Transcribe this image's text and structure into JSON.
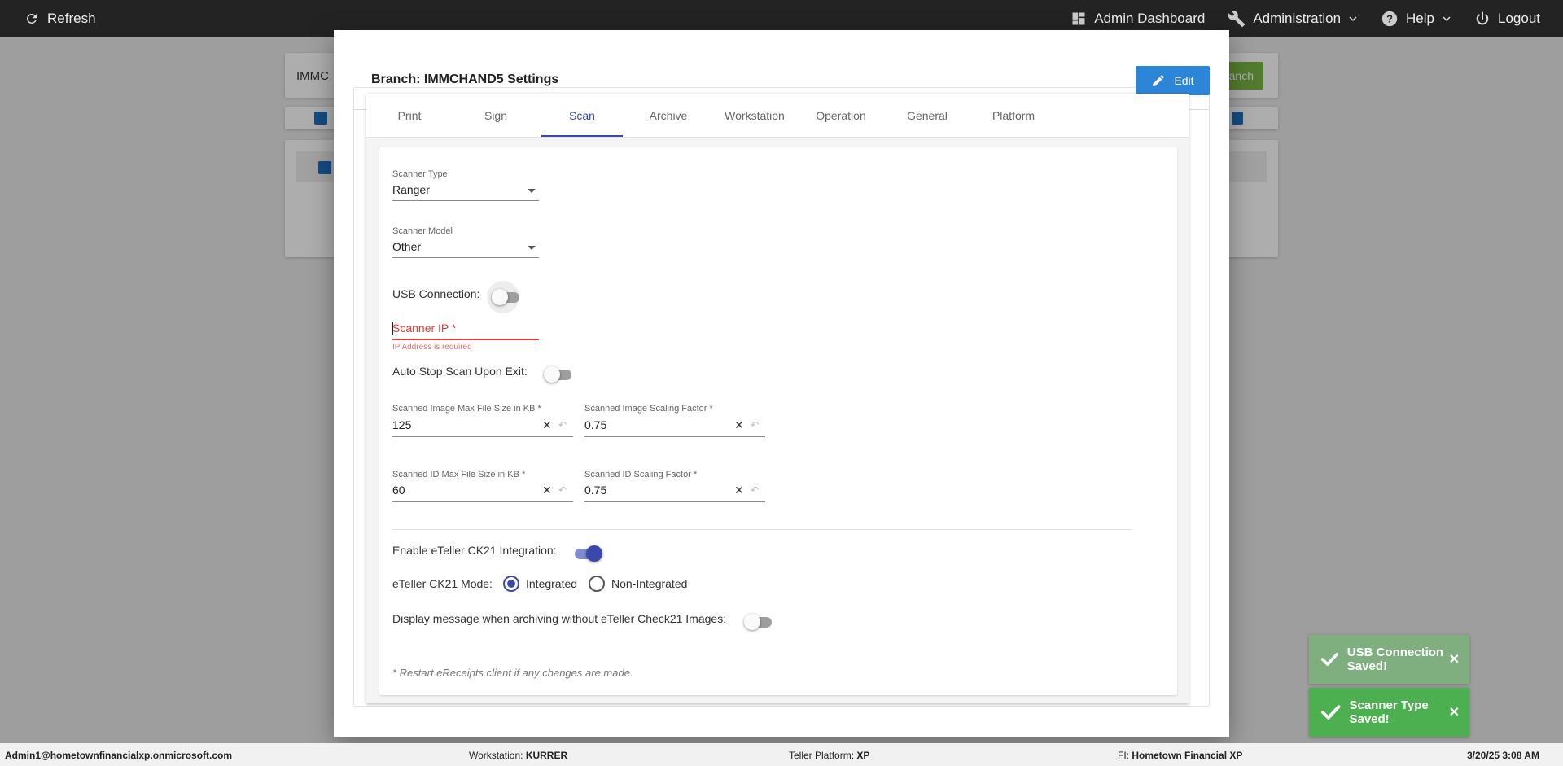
{
  "topnav": {
    "refresh_label": "Refresh",
    "admin_dashboard_label": "Admin Dashboard",
    "administration_label": "Administration",
    "help_label": "Help",
    "logout_label": "Logout"
  },
  "background": {
    "branch_input_partial": "IMMC",
    "branch_button_partial": "anch"
  },
  "modal": {
    "title": "Branch: IMMCHAND5 Settings",
    "edit_label": "Edit",
    "tabs": [
      {
        "label": "Print"
      },
      {
        "label": "Sign"
      },
      {
        "label": "Scan"
      },
      {
        "label": "Archive"
      },
      {
        "label": "Workstation"
      },
      {
        "label": "Operation"
      },
      {
        "label": "General"
      },
      {
        "label": "Platform"
      }
    ],
    "active_tab": "Scan"
  },
  "scan": {
    "scanner_type": {
      "label": "Scanner Type",
      "value": "Ranger"
    },
    "scanner_model": {
      "label": "Scanner Model",
      "value": "Other"
    },
    "usb_connection": {
      "label": "USB Connection:",
      "on": false
    },
    "scanner_ip": {
      "label": "Scanner IP *",
      "value": "",
      "error": "IP Address is required"
    },
    "auto_stop": {
      "label": "Auto Stop Scan Upon Exit:",
      "on": false
    },
    "image_max_size": {
      "label": "Scanned Image Max File Size in KB *",
      "value": "125"
    },
    "image_scaling": {
      "label": "Scanned Image Scaling Factor *",
      "value": "0.75"
    },
    "id_max_size": {
      "label": "Scanned ID Max File Size in KB *",
      "value": "60"
    },
    "id_scaling": {
      "label": "Scanned ID Scaling Factor *",
      "value": "0.75"
    },
    "ck21_integration": {
      "label": "Enable eTeller CK21 Integration:",
      "on": true
    },
    "ck21_mode": {
      "label": "eTeller CK21 Mode:",
      "options": [
        "Integrated",
        "Non-Integrated"
      ],
      "selected": "Integrated"
    },
    "display_message": {
      "label": "Display message when archiving without eTeller Check21 Images:",
      "on": false
    },
    "note": "* Restart eReceipts client if any changes are made."
  },
  "toasts": [
    {
      "message": "USB Connection Saved!",
      "color": "#7fae7f"
    },
    {
      "message": "Scanner Type Saved!",
      "color": "#4caf50"
    }
  ],
  "statusbar": {
    "user": "Admin1@hometownfinancialxp.onmicrosoft.com",
    "workstation_label": "Workstation:",
    "workstation_value": "KURRER",
    "platform_label": "Teller Platform:",
    "platform_value": "XP",
    "fi_label": "FI:",
    "fi_value": "Hometown Financial XP",
    "datetime": "3/20/25 3:08 AM"
  }
}
